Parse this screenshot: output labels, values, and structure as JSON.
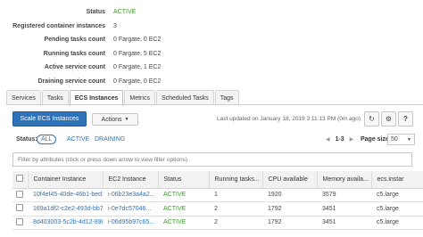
{
  "summary": [
    {
      "label": "Status",
      "value": "ACTIVE",
      "active": true
    },
    {
      "label": "Registered container instances",
      "value": "3"
    },
    {
      "label": "Pending tasks count",
      "value": "0 Fargate, 0 EC2"
    },
    {
      "label": "Running tasks count",
      "value": "0 Fargate, 5 EC2"
    },
    {
      "label": "Active service count",
      "value": "0 Fargate, 1 EC2"
    },
    {
      "label": "Draining service count",
      "value": "0 Fargate, 0 EC2"
    }
  ],
  "tabs": [
    {
      "label": "Services"
    },
    {
      "label": "Tasks"
    },
    {
      "label": "ECS Instances",
      "selected": true
    },
    {
      "label": "Metrics"
    },
    {
      "label": "Scheduled Tasks"
    },
    {
      "label": "Tags"
    }
  ],
  "toolbar": {
    "scale_label": "Scale ECS Instances",
    "actions_label": "Actions",
    "last_updated": "Last updated on January 18, 2019 3:11:13 PM (0m ago)"
  },
  "status_filter": {
    "label": "Status:",
    "all": "ALL",
    "active": "ACTIVE",
    "draining": "DRAINING"
  },
  "pager": {
    "range": "1-3",
    "page_size_label": "Page size",
    "page_size": "50"
  },
  "filter": {
    "placeholder": "Filter by attributes (click or press down arrow to view filter options)"
  },
  "table": {
    "headers": [
      "Container Instance",
      "EC2 Instance",
      "Status",
      "Running tasks...",
      "CPU available",
      "Memory availa...",
      "ecs.instar"
    ],
    "rows": [
      [
        "10f4ef45-40de-46b1-bed2-...",
        "i-06b23e3a4a2...",
        "ACTIVE",
        "1",
        "1920",
        "3579",
        "c5.large"
      ],
      [
        "169a1df2-c2e2-493d-bb77-...",
        "i-0e7dc57046...",
        "ACTIVE",
        "2",
        "1792",
        "3451",
        "c5.large"
      ],
      [
        "8d403003-5c2b-4d12-890b...",
        "i-06d95b97c65...",
        "ACTIVE",
        "2",
        "1792",
        "3451",
        "c5.large"
      ]
    ]
  },
  "colors": {
    "primary": "#2e73b8",
    "active_green": "#3c9d2b"
  }
}
